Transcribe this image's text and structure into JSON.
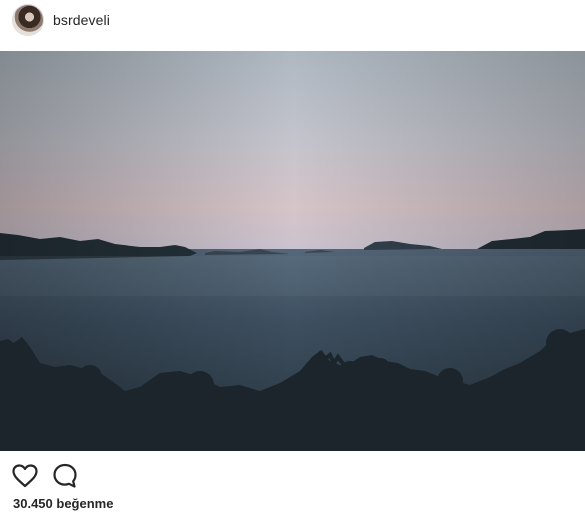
{
  "post": {
    "username": "bsrdeveli",
    "avatar_icon": "profile-photo",
    "photo_description_icon": "seascape-dusk-photo"
  },
  "actions": {
    "like_icon": "heart-icon",
    "comment_icon": "comment-bubble-icon"
  },
  "likes": {
    "count_text": "30.450",
    "label_text": "beğenme"
  },
  "colors": {
    "text": "#262626",
    "background": "#ffffff",
    "sky_top": "#b7c0c8",
    "sky_pink": "#d5c3c6",
    "sea": "#3a4e5b"
  }
}
